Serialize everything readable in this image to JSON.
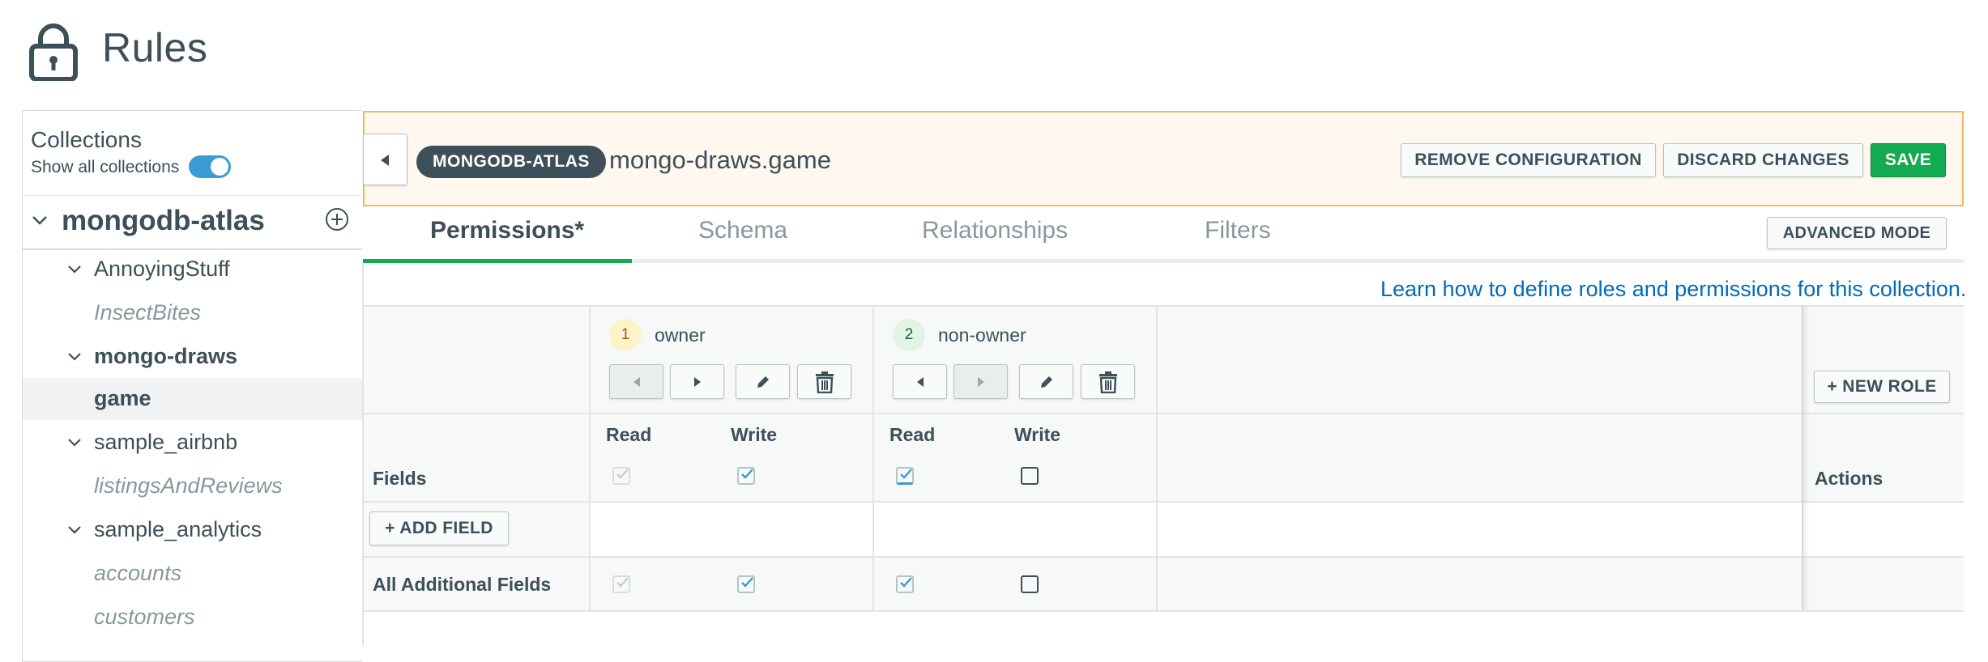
{
  "page": {
    "title": "Rules"
  },
  "sidebar": {
    "header": "Collections",
    "show_all_label": "Show all collections",
    "show_all_enabled": true,
    "data_source": "mongodb-atlas",
    "databases": [
      {
        "name": "AnnoyingStuff",
        "collections": [
          "InsectBites"
        ]
      },
      {
        "name": "mongo-draws",
        "collections": [
          "game"
        ]
      },
      {
        "name": "sample_airbnb",
        "collections": [
          "listingsAndReviews"
        ]
      },
      {
        "name": "sample_analytics",
        "collections": [
          "accounts",
          "customers"
        ]
      }
    ],
    "selected_collection": "game"
  },
  "header_bar": {
    "data_source_pill": "MONGODB-ATLAS",
    "collection_title": "mongo-draws.game",
    "remove_label": "REMOVE CONFIGURATION",
    "discard_label": "DISCARD CHANGES",
    "save_label": "SAVE"
  },
  "tabs": {
    "items": [
      "Permissions*",
      "Schema",
      "Relationships",
      "Filters"
    ],
    "active": "Permissions*",
    "advanced_label": "ADVANCED MODE"
  },
  "learn_link": "Learn how to define roles and permissions for this collection.",
  "roles_table": {
    "new_role_label": "+ NEW ROLE",
    "fields_header": "Fields",
    "actions_header": "Actions",
    "add_field_label": "+ ADD FIELD",
    "read_label": "Read",
    "write_label": "Write",
    "roles": [
      {
        "order": "1",
        "name": "owner",
        "badge_bg": "#fef2c8",
        "badge_fg": "#86681d",
        "read": "checked-disabled",
        "write": "checked",
        "additional_read": "checked-disabled",
        "additional_write": "checked"
      },
      {
        "order": "2",
        "name": "non-owner",
        "badge_bg": "#e4f4e4",
        "badge_fg": "#116149",
        "read": "checked",
        "write": "unchecked",
        "additional_read": "checked",
        "additional_write": "unchecked"
      }
    ],
    "additional_fields_label": "All Additional Fields"
  },
  "colors": {
    "accent_green": "#13aa52",
    "link_blue": "#016bb8",
    "banner_border": "#f0b95a",
    "toggle_blue": "#3b9bd3"
  }
}
